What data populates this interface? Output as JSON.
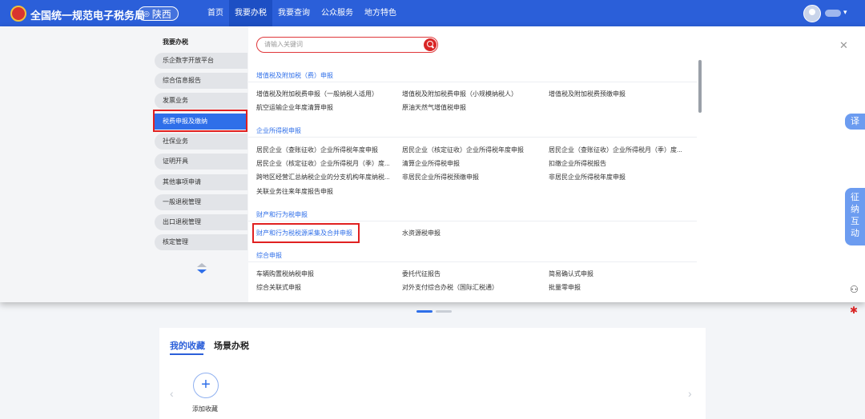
{
  "header": {
    "title": "全国统一规范电子税务局",
    "region": "陕西",
    "nav": [
      "首页",
      "我要办税",
      "我要查询",
      "公众服务",
      "地方特色"
    ],
    "active_nav": "我要办税"
  },
  "sidebar": {
    "heading": "我要办税",
    "items": [
      "乐企数字开放平台",
      "综合信息报告",
      "发票业务",
      "税费申报及缴纳",
      "社保业务",
      "证明开具",
      "其他事项申请",
      "一般退税管理",
      "出口退税管理",
      "核定管理"
    ],
    "active_item": "税费申报及缴纳"
  },
  "search": {
    "placeholder": "请输入关键词"
  },
  "categories": [
    {
      "title": "增值税及附加税（费）申报",
      "items": [
        "增值税及附加税费申报（一般纳税人适用）",
        "增值税及附加税费申报（小规模纳税人）",
        "增值税及附加税费预缴申报",
        "航空运输企业年度清算申报",
        "原油天然气增值税申报"
      ]
    },
    {
      "title": "企业所得税申报",
      "items": [
        "居民企业（查账征收）企业所得税年度申报",
        "居民企业（核定征收）企业所得税年度申报",
        "居民企业（查账征收）企业所得税月（季）度...",
        "居民企业（核定征收）企业所得税月（季）度...",
        "清算企业所得税申报",
        "扣缴企业所得税报告",
        "跨地区经营汇总纳税企业的分支机构年度纳税...",
        "非居民企业所得税预缴申报",
        "非居民企业所得税年度申报",
        "关联业务往来年度报告申报"
      ]
    },
    {
      "title": "财产和行为税申报",
      "items": [
        "财产和行为税税源采集及合并申报",
        "水资源税申报"
      ]
    },
    {
      "title": "综合申报",
      "items": [
        "车辆购置税纳税申报",
        "委托代征报告",
        "简易确认式申报",
        "综合关联式申报",
        "对外支付综合办税（国际汇税通）",
        "批量零申报"
      ]
    }
  ],
  "right_side": {
    "translate": "译",
    "interaction": [
      "征",
      "纳",
      "互",
      "动"
    ]
  },
  "favorites": {
    "tabs": [
      "我的收藏",
      "场景办税"
    ],
    "active_tab": "我的收藏",
    "add_label": "添加收藏"
  },
  "colors": {
    "brand": "#2b5fd9",
    "highlight": "#e02020",
    "accent": "#2f6fe9"
  }
}
